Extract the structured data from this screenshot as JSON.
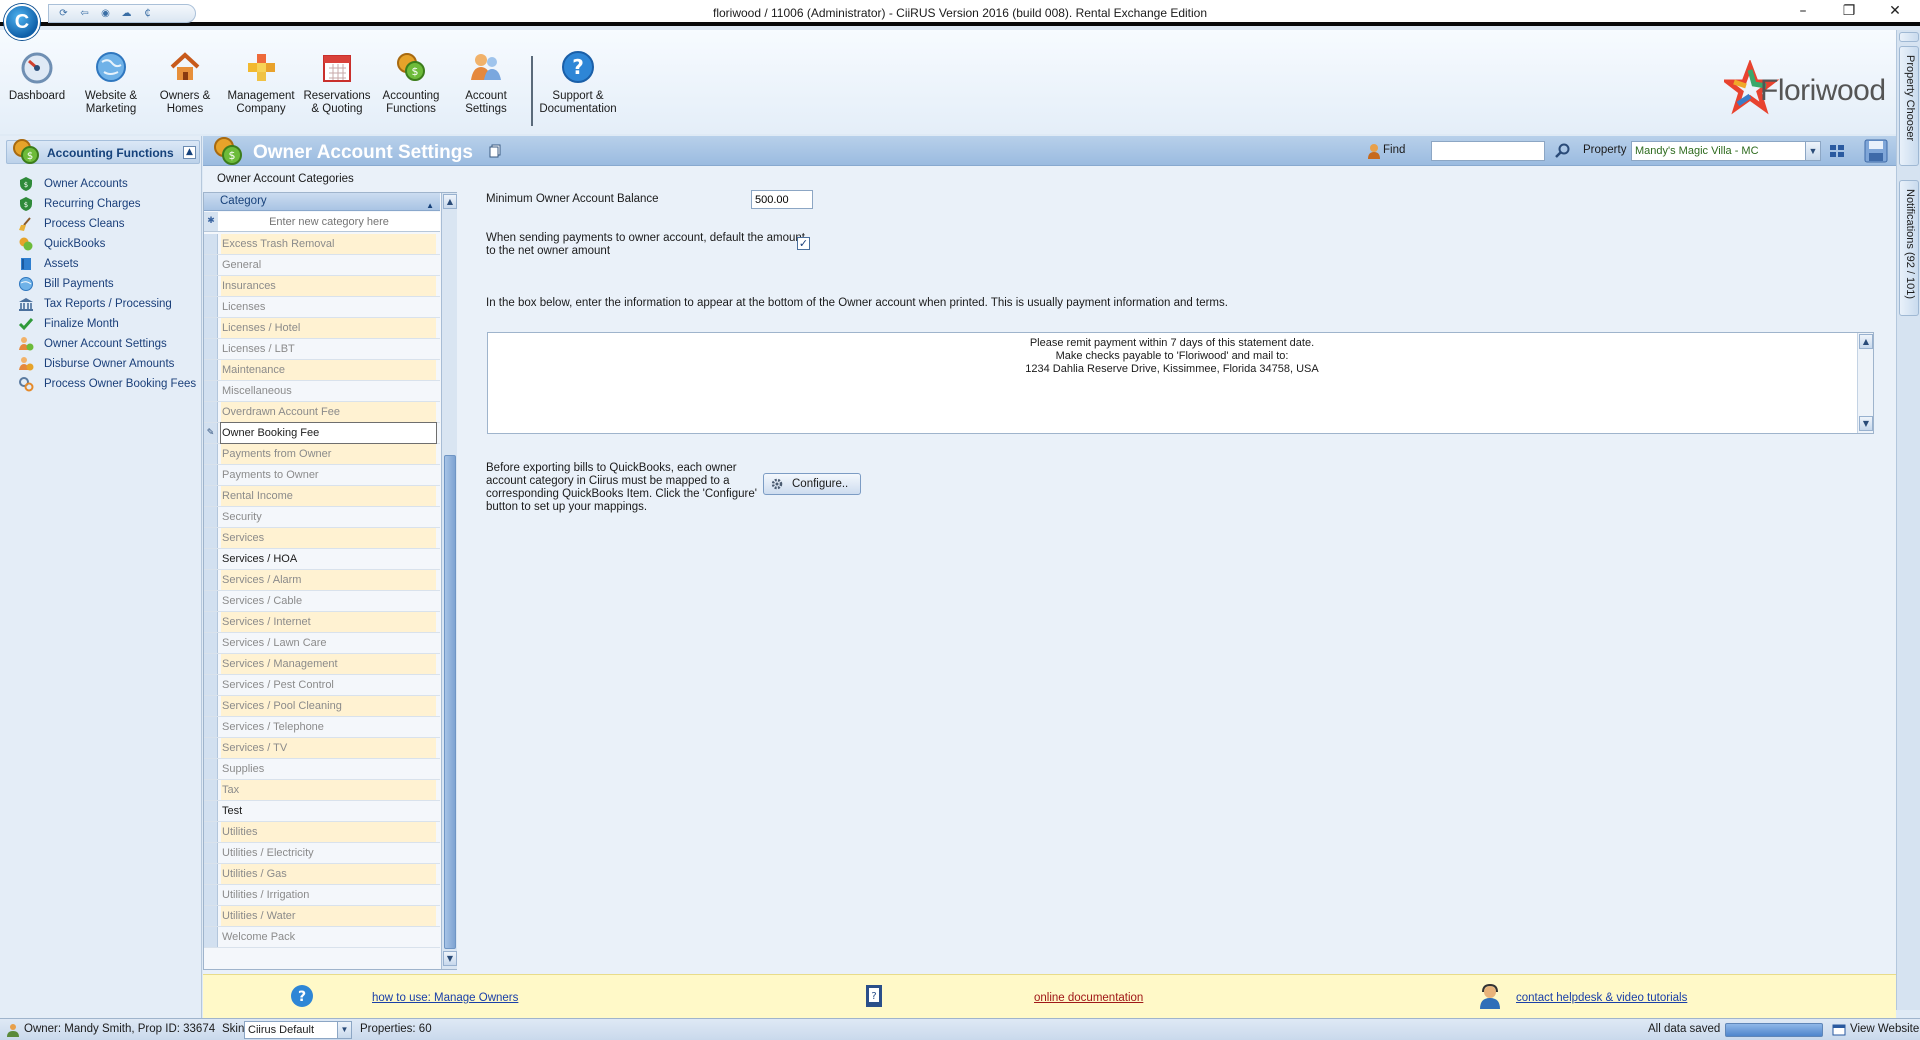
{
  "window": {
    "title": "floriwood / 11006 (Administrator) - CiiRUS Version 2016 (build 008). Rental Exchange Edition"
  },
  "ribbon": {
    "buttons": [
      {
        "id": "dashboard",
        "label": "Dashboard",
        "icon": "speedometer-icon"
      },
      {
        "id": "website",
        "label": "Website & Marketing",
        "icon": "globe-icon"
      },
      {
        "id": "owners",
        "label": "Owners & Homes",
        "icon": "house-icon"
      },
      {
        "id": "management",
        "label": "Management Company",
        "icon": "blocks-icon"
      },
      {
        "id": "reservations",
        "label": "Reservations & Quoting",
        "icon": "calendar-icon"
      },
      {
        "id": "accounting",
        "label": "Accounting Functions",
        "icon": "coins-icon"
      },
      {
        "id": "account",
        "label": "Account Settings",
        "icon": "users-icon"
      },
      {
        "id": "support",
        "label": "Support & Documentation",
        "icon": "help-icon"
      }
    ],
    "logo_text": "Floriwood"
  },
  "right_dock": {
    "property_chooser": "Property Chooser",
    "notifications": "Notifications (92 / 101)"
  },
  "leftnav": {
    "title": "Accounting Functions",
    "items": [
      {
        "label": "Owner Accounts",
        "icon": "shield-icon"
      },
      {
        "label": "Recurring Charges",
        "icon": "shield-icon"
      },
      {
        "label": "Process Cleans",
        "icon": "broom-icon"
      },
      {
        "label": "QuickBooks",
        "icon": "coins-icon"
      },
      {
        "label": "Assets",
        "icon": "book-icon"
      },
      {
        "label": "Bill Payments",
        "icon": "globe-icon"
      },
      {
        "label": "Tax Reports / Processing",
        "icon": "bank-icon"
      },
      {
        "label": "Finalize Month",
        "icon": "check-icon"
      },
      {
        "label": "Owner Account Settings",
        "icon": "person-coins-icon"
      },
      {
        "label": "Disburse Owner Amounts",
        "icon": "person-coins-icon"
      },
      {
        "label": "Process Owner Booking Fees",
        "icon": "gears-icon"
      }
    ]
  },
  "page": {
    "title": "Owner Account Settings",
    "find_label": "Find",
    "find_value": "",
    "property_label": "Property",
    "property_value": "Mandy's Magic Villa - MC"
  },
  "categories": {
    "caption": "Owner Account Categories",
    "column": "Category",
    "new_placeholder": "Enter new category here",
    "rows": [
      {
        "label": "Excess Trash Removal",
        "style": "alt"
      },
      {
        "label": "General",
        "style": ""
      },
      {
        "label": "Insurances",
        "style": "alt"
      },
      {
        "label": "Licenses",
        "style": ""
      },
      {
        "label": "Licenses / Hotel",
        "style": "alt"
      },
      {
        "label": "Licenses / LBT",
        "style": ""
      },
      {
        "label": "Maintenance",
        "style": "alt"
      },
      {
        "label": "Miscellaneous",
        "style": ""
      },
      {
        "label": "Overdrawn Account Fee",
        "style": "alt"
      },
      {
        "label": "Owner Booking Fee",
        "style": "selected"
      },
      {
        "label": "Payments from Owner",
        "style": "alt"
      },
      {
        "label": "Payments to Owner",
        "style": ""
      },
      {
        "label": "Rental Income",
        "style": "alt"
      },
      {
        "label": "Security",
        "style": ""
      },
      {
        "label": "Services",
        "style": "alt"
      },
      {
        "label": "Services / HOA",
        "style": "dark"
      },
      {
        "label": "Services / Alarm",
        "style": "alt"
      },
      {
        "label": "Services / Cable",
        "style": ""
      },
      {
        "label": "Services / Internet",
        "style": "alt"
      },
      {
        "label": "Services / Lawn Care",
        "style": ""
      },
      {
        "label": "Services / Management",
        "style": "alt"
      },
      {
        "label": "Services / Pest Control",
        "style": ""
      },
      {
        "label": "Services / Pool Cleaning",
        "style": "alt"
      },
      {
        "label": "Services / Telephone",
        "style": ""
      },
      {
        "label": "Services / TV",
        "style": "alt"
      },
      {
        "label": "Supplies",
        "style": ""
      },
      {
        "label": "Tax",
        "style": "alt"
      },
      {
        "label": "Test",
        "style": "dark"
      },
      {
        "label": "Utilities",
        "style": "alt"
      },
      {
        "label": "Utilities / Electricity",
        "style": ""
      },
      {
        "label": "Utilities / Gas",
        "style": "alt"
      },
      {
        "label": "Utilities / Irrigation",
        "style": ""
      },
      {
        "label": "Utilities / Water",
        "style": "alt"
      },
      {
        "label": "Welcome Pack",
        "style": ""
      }
    ]
  },
  "settings": {
    "min_balance_label": "Minimum Owner Account Balance",
    "min_balance_value": "500.00",
    "default_amount_line1": "When sending payments to owner account, default the amount",
    "default_amount_line2": "to the net owner amount",
    "default_amount_checked": true,
    "terms_instruction": "In the box below, enter the information to appear at the bottom of the Owner account when printed. This is usually payment information and terms.",
    "terms_lines": [
      "Please remit payment within 7 days of this statement date.",
      "Make checks payable to 'Floriwood' and mail to:",
      "1234 Dahlia Reserve Drive, Kissimmee, Florida 34758, USA"
    ],
    "qb_lines": [
      "Before exporting bills to QuickBooks, each owner",
      "account category in Ciirus must be mapped to a",
      "corresponding QuickBooks Item. Click the 'Configure'",
      "button to set up your mappings."
    ],
    "configure_label": "Configure.."
  },
  "helpbar": {
    "manage_owners": "how to use: Manage Owners",
    "online_docs": "online documentation",
    "helpdesk": "contact helpdesk & video tutorials"
  },
  "status": {
    "owner": "Owner: Mandy Smith, Prop ID: 33674",
    "skin_label": "Skin",
    "skin_value": "Ciirus Default",
    "properties": "Properties: 60",
    "saved": "All data saved",
    "view_website": "View Website"
  }
}
